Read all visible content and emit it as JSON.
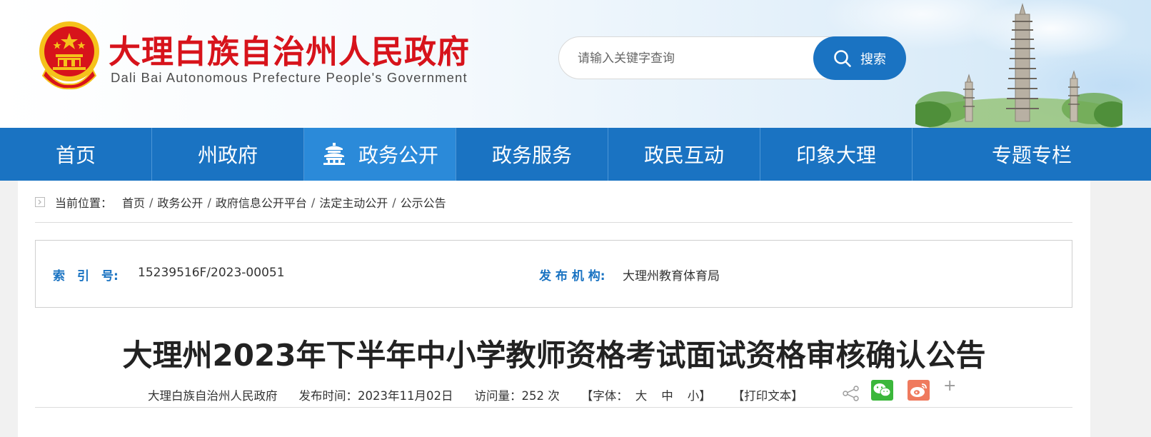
{
  "header": {
    "title": "大理白族自治州人民政府",
    "subtitle": "Dali Bai Autonomous Prefecture People's Government",
    "search": {
      "placeholder": "请输入关键字查询",
      "button_label": "搜索"
    }
  },
  "nav": {
    "items": [
      {
        "label": "首页"
      },
      {
        "label": "州政府"
      },
      {
        "label": "政务公开",
        "active": true
      },
      {
        "label": "政务服务"
      },
      {
        "label": "政民互动"
      },
      {
        "label": "印象大理"
      },
      {
        "label": "专题专栏"
      }
    ]
  },
  "breadcrumb": {
    "label": "当前位置：",
    "items": [
      "首页",
      "政务公开",
      "政府信息公开平台",
      "法定主动公开",
      "公示公告"
    ],
    "separator": "/"
  },
  "info": {
    "index_label": "索　引　号:",
    "index_value": "15239516F/2023-00051",
    "publisher_label": "发 布 机 构:",
    "publisher_value": "大理州教育体育局"
  },
  "article": {
    "title": "大理州2023年下半年中小学教师资格考试面试资格审核确认公告",
    "source": "大理白族自治州人民政府",
    "publish_time": "发布时间：2023年11月02日",
    "views": "访问量：252 次",
    "font_label": "【字体：",
    "font_large": "大",
    "font_medium": "中",
    "font_small": "小】",
    "print_label": "【打印文本】"
  },
  "share": {
    "icons": [
      "share-icon",
      "wechat-icon",
      "weibo-icon",
      "more-icon"
    ],
    "more_label": "+"
  },
  "colors": {
    "brand_blue": "#1a73c2",
    "title_red": "#d7131b",
    "nav_active": "#2b8ad9"
  }
}
